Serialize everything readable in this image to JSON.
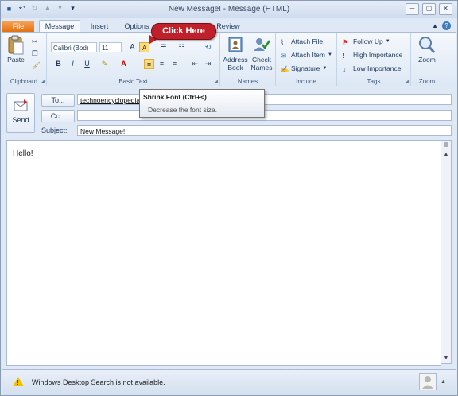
{
  "window": {
    "title": "New Message! - Message (HTML)",
    "controls": {
      "minimize": "─",
      "restore": "▢",
      "close": "✕"
    }
  },
  "qat": {
    "save": "💾",
    "undo": "↶",
    "redo": "↻",
    "up": "▲",
    "down": "▼",
    "customize": "▾"
  },
  "tabs": {
    "file": "File",
    "message": "Message",
    "insert": "Insert",
    "options": "Options",
    "review": "Review"
  },
  "callout": {
    "text": "Click Here"
  },
  "ribbon": {
    "clipboard": {
      "label": "Clipboard",
      "paste": "Paste"
    },
    "basic_text": {
      "label": "Basic Text",
      "font": "Calibri (Bod)",
      "size": "11",
      "bold": "B",
      "italic": "I",
      "underline": "U",
      "grow": "A",
      "shrink": "A"
    },
    "names": {
      "label": "Names",
      "address_book_1": "Address",
      "address_book_2": "Book",
      "check_names_1": "Check",
      "check_names_2": "Names"
    },
    "include": {
      "label": "Include",
      "attach_file": "Attach File",
      "attach_item": "Attach Item",
      "signature": "Signature"
    },
    "tags": {
      "label": "Tags",
      "follow_up": "Follow Up",
      "high": "High Importance",
      "low": "Low Importance"
    },
    "zoom": {
      "label": "Zoom",
      "zoom": "Zoom"
    }
  },
  "tooltip": {
    "title": "Shrink Font (Ctrl+<)",
    "description": "Decrease the font size."
  },
  "header": {
    "send": "Send",
    "to_button": "To...",
    "cc_button": "Cc...",
    "subject_label": "Subject:",
    "to_value": "technoencyclopedia@",
    "cc_value": "",
    "subject_value": "New Message!"
  },
  "body": {
    "text": "Hello!"
  },
  "status": {
    "text": "Windows Desktop Search is not available."
  },
  "colors": {
    "file_tab": "#e46c0a",
    "callout": "#c0202a",
    "warning": "#f2c200",
    "highlight_btn": "#fddb7a"
  }
}
